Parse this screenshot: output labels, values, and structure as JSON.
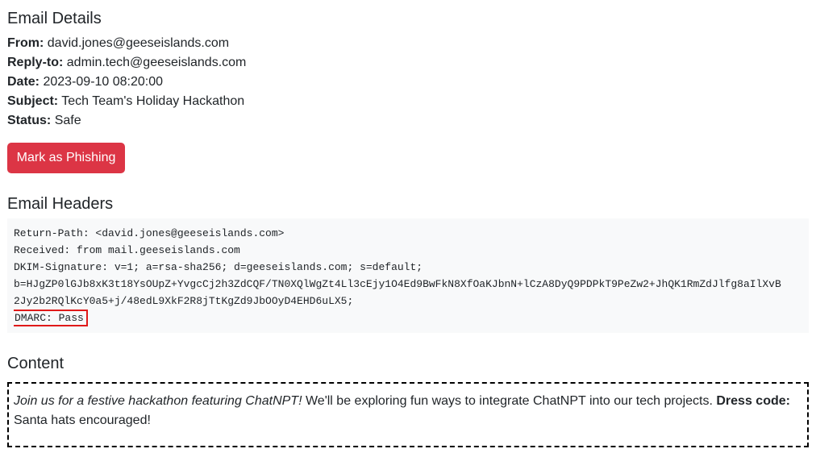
{
  "details": {
    "heading": "Email Details",
    "fields": [
      {
        "label": "From:",
        "value": "david.jones@geeseislands.com"
      },
      {
        "label": "Reply-to:",
        "value": "admin.tech@geeseislands.com"
      },
      {
        "label": "Date:",
        "value": "2023-09-10 08:20:00"
      },
      {
        "label": "Subject:",
        "value": "Tech Team's Holiday Hackathon"
      },
      {
        "label": "Status:",
        "value": "Safe"
      }
    ],
    "phish_button": "Mark as Phishing"
  },
  "headers": {
    "heading": "Email Headers",
    "lines": [
      "Return-Path: <david.jones@geeseislands.com>",
      "Received: from mail.geeseislands.com",
      "DKIM-Signature: v=1; a=rsa-sha256; d=geeseislands.com; s=default;",
      "b=HJgZP0lGJb8xK3t18YsOUpZ+YvgcCj2h3ZdCQF/TN0XQlWgZt4Ll3cEjy1O4Ed9BwFkN8XfOaKJbnN+lCzA8DyQ9PDPkT9PeZw2+JhQK1RmZdJlfg8aIlXvB",
      "2Jy2b2RQlKcY0a5+j/48edL9XkF2R8jTtKgZd9JbOOyD4EHD6uLX5;"
    ],
    "dmarc": "DMARC: Pass",
    "highlight_color": "#e01919"
  },
  "content": {
    "heading": "Content",
    "italic_text": "Join us for a festive hackathon featuring ChatNPT!",
    "body_text": " We'll be exploring fun ways to integrate ChatNPT into our tech projects. ",
    "bold_text": "Dress code:",
    "tail_text": " Santa hats encouraged!"
  },
  "colors": {
    "danger": "#dc3545",
    "code_bg": "#f8f9fa",
    "text": "#212529"
  }
}
